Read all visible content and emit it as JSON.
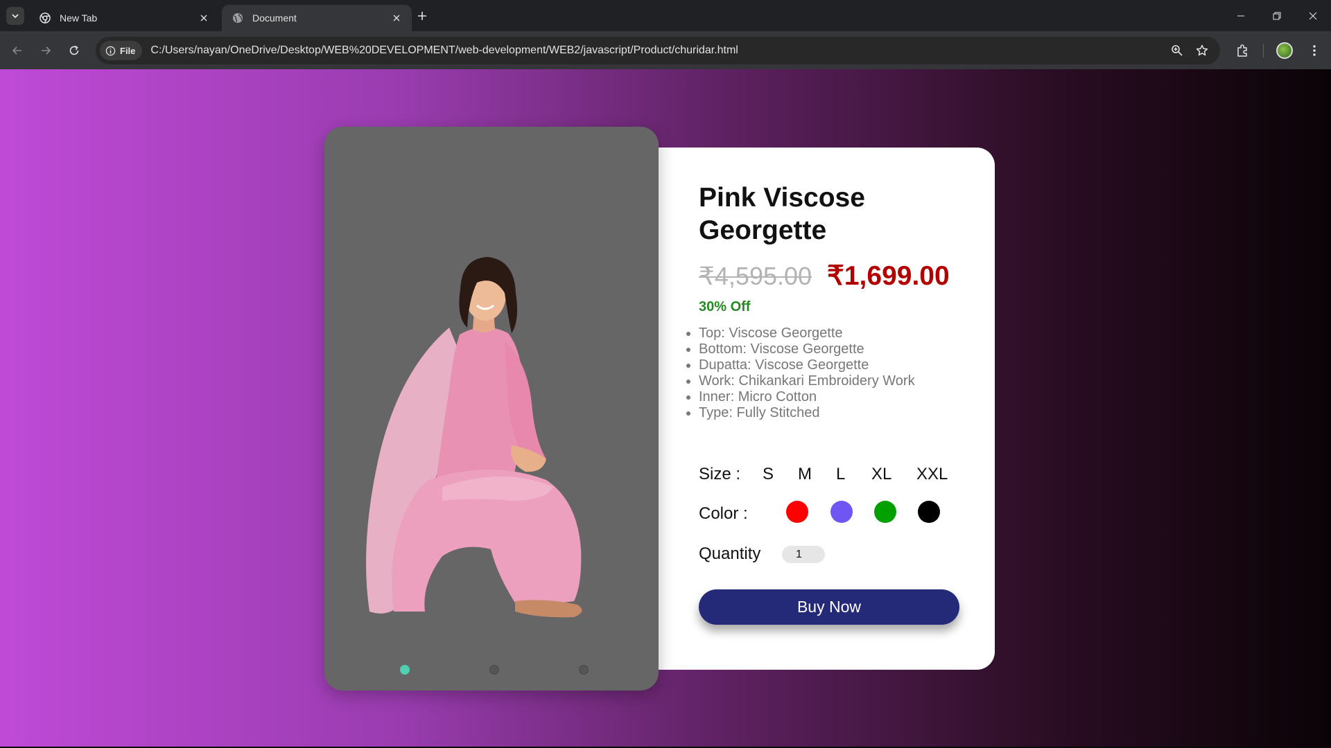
{
  "browser": {
    "tabs": [
      {
        "title": "New Tab",
        "active": false
      },
      {
        "title": "Document",
        "active": true
      }
    ],
    "site_chip": "File",
    "url": "C:/Users/nayan/OneDrive/Desktop/WEB%20DEVELOPMENT/web-development/WEB2/javascript/Product/churidar.html"
  },
  "product": {
    "title": "Pink Viscose Georgette",
    "old_price": "₹4,595.00",
    "new_price": "₹1,699.00",
    "discount": "30% Off",
    "details": [
      "Top: Viscose Georgette",
      "Bottom: Viscose Georgette",
      "Dupatta: Viscose Georgette",
      "Work: Chikankari Embroidery Work",
      "Inner: Micro Cotton",
      "Type: Fully Stitched"
    ],
    "size_label": "Size :",
    "sizes": [
      "S",
      "M",
      "L",
      "XL",
      "XXL"
    ],
    "color_label": "Color :",
    "colors": [
      "#ff0000",
      "#7055f5",
      "#00a000",
      "#000000"
    ],
    "quantity_label": "Quantity",
    "quantity_value": "1",
    "buy_label": "Buy Now",
    "carousel": {
      "slides": 3,
      "active": 1,
      "active_color": "#4fd1b0"
    }
  }
}
